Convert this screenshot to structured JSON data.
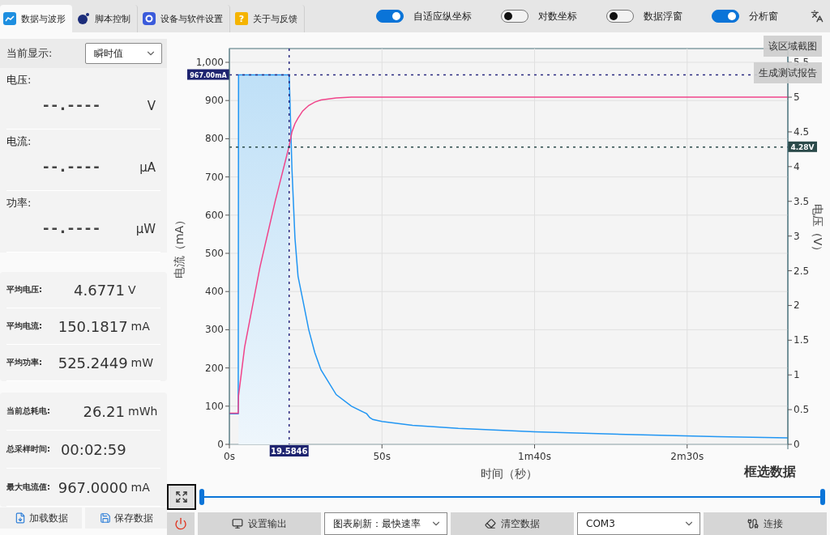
{
  "tabs": [
    {
      "label": "数据与波形",
      "selected": true
    },
    {
      "label": "脚本控制",
      "selected": false
    },
    {
      "label": "设备与软件设置",
      "selected": false
    },
    {
      "label": "关于与反馈",
      "selected": false,
      "icon_glyph": "?"
    }
  ],
  "toggles": [
    {
      "label": "自适应纵坐标",
      "on": true
    },
    {
      "label": "对数坐标",
      "on": false
    },
    {
      "label": "数据浮窗",
      "on": false
    },
    {
      "label": "分析窗",
      "on": true
    }
  ],
  "display_select": {
    "label": "当前显示:",
    "value": "瞬时值"
  },
  "readings": [
    {
      "label": "电压:",
      "value": "--.----",
      "unit": "V"
    },
    {
      "label": "电流:",
      "value": "--.----",
      "unit": "μA"
    },
    {
      "label": "功率:",
      "value": "--.----",
      "unit": "μW"
    }
  ],
  "averages": [
    {
      "label": "平均电压:",
      "value": "4.6771",
      "unit": "V"
    },
    {
      "label": "平均电流:",
      "value": "150.1817",
      "unit": "mA"
    },
    {
      "label": "平均功率:",
      "value": "525.2449",
      "unit": "mW"
    }
  ],
  "totals": [
    {
      "label": "当前总耗电:",
      "value": "26.21",
      "unit": "mWh"
    },
    {
      "label": "总采样时间:",
      "value": "00:02:59"
    },
    {
      "label": "最大电流值:",
      "value": "967.0000",
      "unit": "mA"
    }
  ],
  "side_buttons": [
    {
      "label": "加载数据"
    },
    {
      "label": "保存数据"
    }
  ],
  "chart": {
    "actions": [
      "该区域截图",
      "生成测试报告"
    ],
    "select_label": "框选数据",
    "chart_data": {
      "type": "line",
      "xlabel": "时间（秒）",
      "ylabel": "电流（mA）",
      "y2label": "电压（V）",
      "x": [
        0,
        2.9,
        3.0,
        5,
        10,
        15,
        19.6,
        20.5,
        21.5,
        22.5,
        24,
        26,
        28,
        30,
        35,
        40,
        45,
        46,
        47,
        50,
        60,
        75,
        100,
        130,
        160,
        183
      ],
      "series": [
        {
          "color": "#2196f3",
          "axis": "y",
          "values": [
            80,
            80,
            967,
            967,
            967,
            967,
            967,
            720,
            540,
            440,
            380,
            300,
            240,
            195,
            130,
            100,
            80,
            70,
            65,
            60,
            50,
            42,
            33,
            26,
            20,
            17
          ]
        },
        {
          "color": "#f0448a",
          "axis": "y2",
          "values": [
            0.45,
            0.45,
            0.7,
            1.4,
            2.55,
            3.5,
            4.3,
            4.5,
            4.62,
            4.7,
            4.8,
            4.88,
            4.93,
            4.96,
            4.99,
            5,
            5,
            5,
            5,
            5,
            5,
            5,
            5,
            5,
            5,
            5
          ]
        }
      ],
      "xlim": [
        0,
        183
      ],
      "ylim": [
        0,
        1036
      ],
      "y2lim": [
        0,
        5.7
      ],
      "xticks": [
        {
          "value": 0,
          "label": "0s"
        },
        {
          "value": 50,
          "label": "50s"
        },
        {
          "value": 100,
          "label": "1m40s"
        },
        {
          "value": 150,
          "label": "2m30s"
        }
      ],
      "yticks": [
        {
          "value": 0,
          "label": "0"
        },
        {
          "value": 100,
          "label": "100"
        },
        {
          "value": 200,
          "label": "200"
        },
        {
          "value": 300,
          "label": "300"
        },
        {
          "value": 400,
          "label": "400"
        },
        {
          "value": 500,
          "label": "500"
        },
        {
          "value": 600,
          "label": "600"
        },
        {
          "value": 700,
          "label": "700"
        },
        {
          "value": 800,
          "label": "800"
        },
        {
          "value": 900,
          "label": "900"
        },
        {
          "value": 1000,
          "label": "1,000"
        }
      ],
      "y2ticks": [
        {
          "value": 0,
          "label": "0"
        },
        {
          "value": 0.5,
          "label": "0.5"
        },
        {
          "value": 1,
          "label": "1"
        },
        {
          "value": 1.5,
          "label": "1.5"
        },
        {
          "value": 2,
          "label": "2"
        },
        {
          "value": 2.5,
          "label": "2.5"
        },
        {
          "value": 3,
          "label": "3"
        },
        {
          "value": 3.5,
          "label": "3.5"
        },
        {
          "value": 4,
          "label": "4"
        },
        {
          "value": 4.5,
          "label": "4.5"
        },
        {
          "value": 5,
          "label": "5"
        },
        {
          "value": 5.5,
          "label": "5.5"
        }
      ],
      "grid": true,
      "ref_lines": [
        {
          "axis": "x",
          "value": 19.5846,
          "label": "19.5846"
        },
        {
          "axis": "y",
          "value": 967,
          "label": "967.00mA"
        },
        {
          "axis": "y2",
          "value": 4.28,
          "label": "4.28V"
        }
      ]
    }
  },
  "range_slider": {
    "level": 1
  },
  "toolbar": {
    "output_button": "设置输出",
    "refresh_select": "图表刷新：最快速率",
    "clear_button": "清空数据",
    "port_select": "COM3",
    "connect_button": "连接"
  }
}
